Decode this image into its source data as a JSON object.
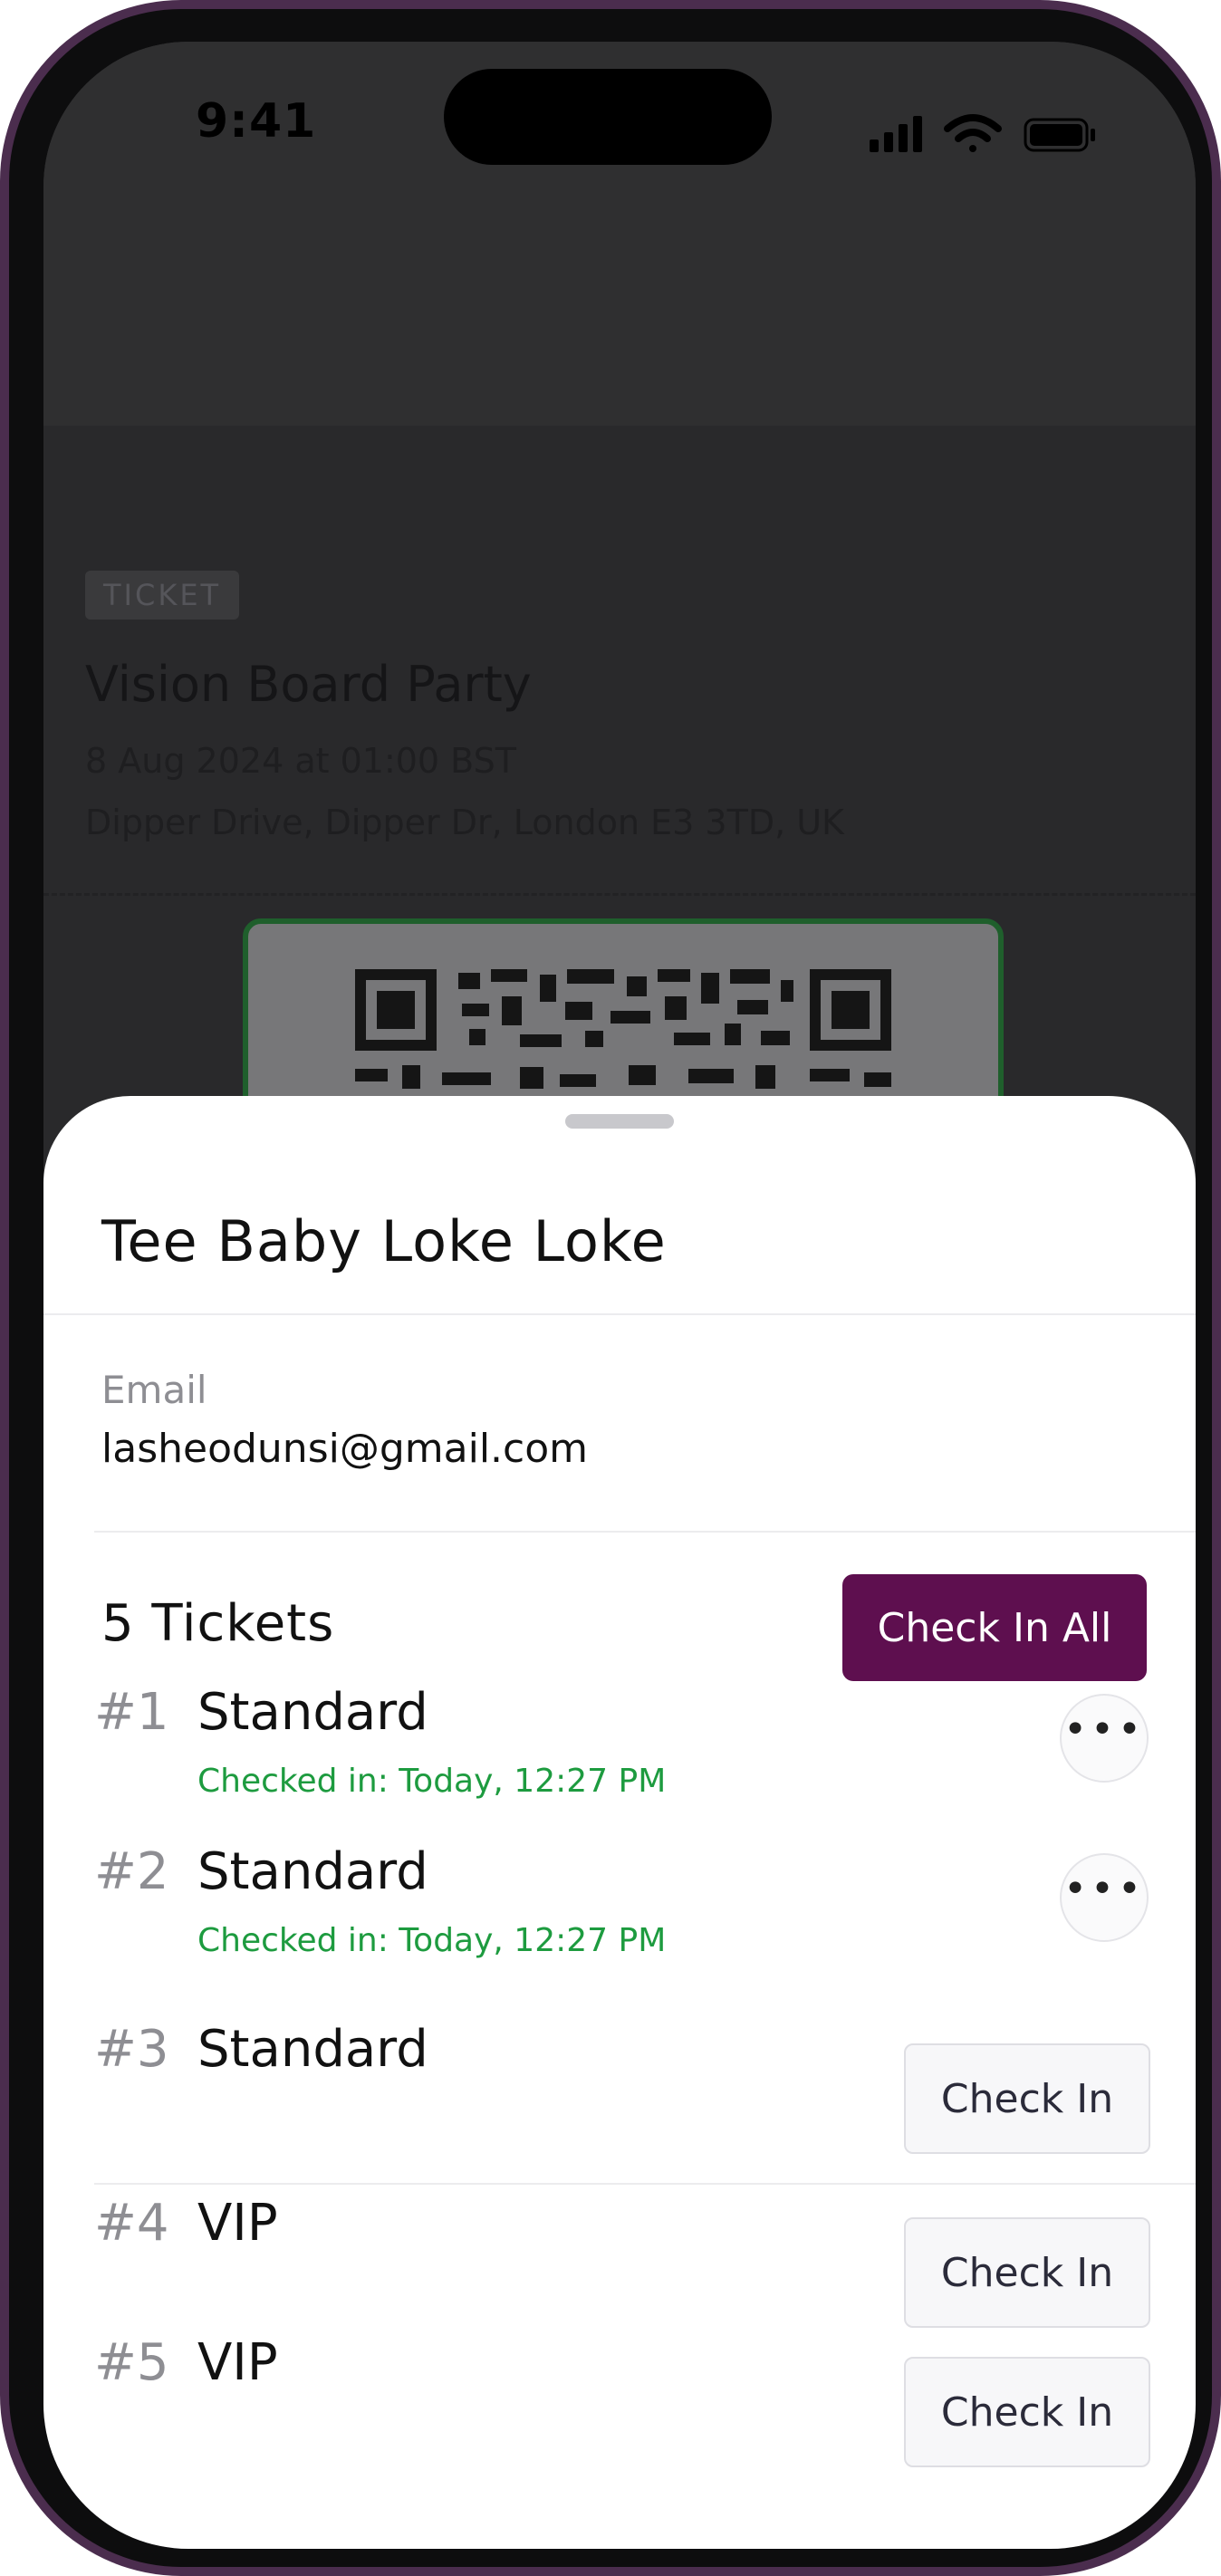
{
  "status_bar": {
    "time": "9:41",
    "icons": [
      "signal-icon",
      "wifi-icon",
      "battery-icon"
    ]
  },
  "background_ticket": {
    "tag": "TICKET",
    "title": "Vision Board Party",
    "date": "8 Aug 2024 at 01:00 BST",
    "venue": "Dipper Drive, Dipper Dr, London E3 3TD, UK"
  },
  "sheet": {
    "guest_name": "Tee Baby Loke Loke",
    "email_label": "Email",
    "email_value": "lasheodunsi@gmail.com",
    "tickets_count": "5 Tickets",
    "check_in_all_label": "Check In All",
    "tickets": [
      {
        "number": "#1",
        "type": "Standard",
        "status": "Checked in: Today, 12:27 PM",
        "action": "more"
      },
      {
        "number": "#2",
        "type": "Standard",
        "status": "Checked in: Today, 12:27 PM",
        "action": "more"
      },
      {
        "number": "#3",
        "type": "Standard",
        "action_label": "Check In"
      },
      {
        "number": "#4",
        "type": "VIP",
        "action_label": "Check In"
      },
      {
        "number": "#5",
        "type": "VIP",
        "action_label": "Check In"
      }
    ]
  },
  "colors": {
    "accent": "#5e0f4f",
    "checked_in": "#1d9b3f",
    "frame": "#4b2d4e"
  }
}
